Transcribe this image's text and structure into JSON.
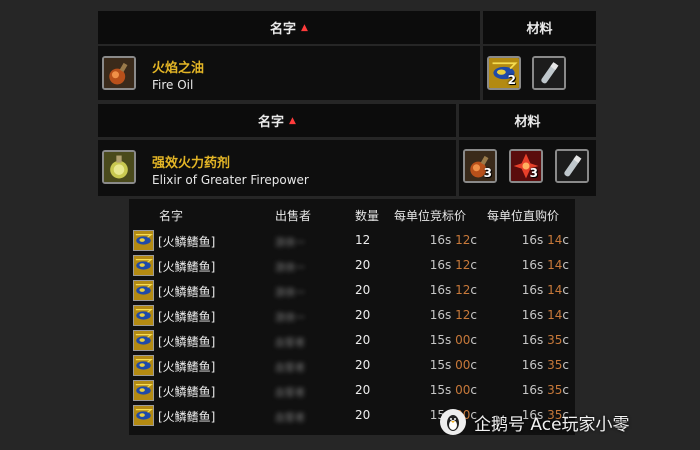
{
  "header1": {
    "name_label": "名字",
    "sort_arrow": "▲",
    "materials_label": "材料"
  },
  "recipe1": {
    "name_cn": "火焰之油",
    "name_en": "Fire Oil",
    "icon": "fire-oil-flask-icon",
    "reagents": [
      {
        "icon": "scale-fish-icon",
        "count": "2"
      },
      {
        "icon": "empty-vial-icon",
        "count": ""
      }
    ]
  },
  "header2": {
    "name_label": "名字",
    "sort_arrow": "▲",
    "materials_label": "材料"
  },
  "recipe2": {
    "name_cn": "强效火力药剂",
    "name_en": "Elixir of Greater Firepower",
    "icon": "elixir-flask-icon",
    "reagents": [
      {
        "icon": "fire-oil-flask-icon",
        "count": "3"
      },
      {
        "icon": "red-crystal-icon",
        "count": "3"
      },
      {
        "icon": "empty-vial-icon",
        "count": ""
      }
    ]
  },
  "auction": {
    "columns": [
      "名字",
      "出售者",
      "数量",
      "每单位竞标价",
      "每单位直购价"
    ],
    "rows": [
      {
        "name": "[火鳞鳍鱼]",
        "seller": "游侠一",
        "qty": "12",
        "bid_s": "16",
        "bid_c": "12",
        "buy_s": "16",
        "buy_c": "14"
      },
      {
        "name": "[火鳞鳍鱼]",
        "seller": "游侠一",
        "qty": "20",
        "bid_s": "16",
        "bid_c": "12",
        "buy_s": "16",
        "buy_c": "14"
      },
      {
        "name": "[火鳞鳍鱼]",
        "seller": "游侠一",
        "qty": "20",
        "bid_s": "16",
        "bid_c": "12",
        "buy_s": "16",
        "buy_c": "14"
      },
      {
        "name": "[火鳞鳍鱼]",
        "seller": "游侠一",
        "qty": "20",
        "bid_s": "16",
        "bid_c": "12",
        "buy_s": "16",
        "buy_c": "14"
      },
      {
        "name": "[火鳞鳍鱼]",
        "seller": "血誓者",
        "qty": "20",
        "bid_s": "15",
        "bid_c": "00",
        "buy_s": "16",
        "buy_c": "35"
      },
      {
        "name": "[火鳞鳍鱼]",
        "seller": "血誓者",
        "qty": "20",
        "bid_s": "15",
        "bid_c": "00",
        "buy_s": "16",
        "buy_c": "35"
      },
      {
        "name": "[火鳞鳍鱼]",
        "seller": "血誓者",
        "qty": "20",
        "bid_s": "15",
        "bid_c": "00",
        "buy_s": "16",
        "buy_c": "35"
      },
      {
        "name": "[火鳞鳍鱼]",
        "seller": "血誓者",
        "qty": "20",
        "bid_s": "15",
        "bid_c": "00",
        "buy_s": "16",
        "buy_c": "35"
      }
    ],
    "silver_unit": "s",
    "copper_unit": "c"
  },
  "watermark": {
    "text": "企鹅号 Ace玩家小零",
    "logo_icon": "penguin-logo-icon"
  },
  "colors": {
    "gold_title": "#e3b526",
    "copper": "#c8793a",
    "sort_arrow": "#ff3b3b",
    "background": "#262626"
  }
}
